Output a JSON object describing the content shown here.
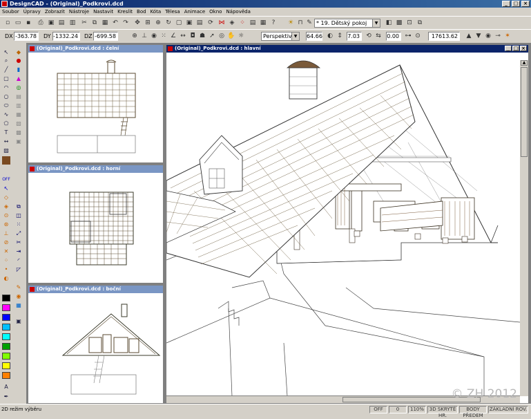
{
  "app": {
    "title": "DesignCAD - (Original)_Podkrovi.dcd"
  },
  "menu": [
    "Soubor",
    "Úpravy",
    "Zobrazit",
    "Nástroje",
    "Nastavit",
    "Kreslit",
    "Bod",
    "Kóta",
    "Tělesa",
    "Animace",
    "Okno",
    "Nápověda"
  ],
  "toolbar1": {
    "layer_combo": "*  19. Dětský pokoj"
  },
  "toolbar2": {
    "dx_label": "DX",
    "dx_value": "-363.78",
    "dy_label": "DY",
    "dy_value": "-1332.24",
    "dz_label": "DZ",
    "dz_value": "-699.58",
    "projection": "Perspektiva",
    "v1": "64.66",
    "v2": "7.03",
    "v3": "0.00",
    "v4": "17613.62"
  },
  "windows": {
    "front": "(Original)_Podkrovi.dcd : čelní",
    "top": "(Original)_Podkrovi.dcd : horní",
    "side": "(Original)_Podkrovi.dcd : boční",
    "main": "(Original)_Podkrovi.dcd : hlavní"
  },
  "status": {
    "left": "2D režim výběru",
    "off": "OFF",
    "zero": "0",
    "zoom": "110%",
    "hidden": "3D SKRYTÉ HR.",
    "front_pts": "BODY PŘEDEM",
    "layer": "ZÁKLADNÍ ROV."
  },
  "watermark": "© ZH 2012",
  "colors": {
    "title_bar": "#0a246a",
    "palette": [
      "#000000",
      "#ff00ff",
      "#0000ff",
      "#00c0ff",
      "#00ffff",
      "#00a000",
      "#80ff00",
      "#ffff00",
      "#ff8000"
    ]
  }
}
